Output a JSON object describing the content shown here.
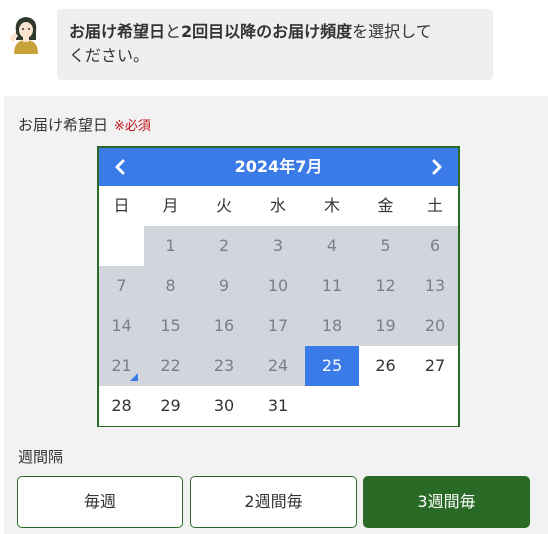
{
  "message": {
    "bold1": "お届け希望日",
    "text1": "と",
    "bold2": "2回目以降のお届け頻度",
    "text2": "を選択して",
    "line2": "ください。"
  },
  "delivery_date": {
    "label": "お届け希望日",
    "required": "※必須"
  },
  "calendar": {
    "title": "2024年7月",
    "weekdays": [
      "日",
      "月",
      "火",
      "水",
      "木",
      "金",
      "土"
    ],
    "weeks": [
      [
        {
          "d": "",
          "s": "empty"
        },
        {
          "d": "1",
          "s": "dis"
        },
        {
          "d": "2",
          "s": "dis"
        },
        {
          "d": "3",
          "s": "dis"
        },
        {
          "d": "4",
          "s": "dis"
        },
        {
          "d": "5",
          "s": "dis"
        },
        {
          "d": "6",
          "s": "dis"
        }
      ],
      [
        {
          "d": "7",
          "s": "dis"
        },
        {
          "d": "8",
          "s": "dis"
        },
        {
          "d": "9",
          "s": "dis"
        },
        {
          "d": "10",
          "s": "dis"
        },
        {
          "d": "11",
          "s": "dis"
        },
        {
          "d": "12",
          "s": "dis"
        },
        {
          "d": "13",
          "s": "dis"
        }
      ],
      [
        {
          "d": "14",
          "s": "dis"
        },
        {
          "d": "15",
          "s": "dis"
        },
        {
          "d": "16",
          "s": "dis"
        },
        {
          "d": "17",
          "s": "dis"
        },
        {
          "d": "18",
          "s": "dis"
        },
        {
          "d": "19",
          "s": "dis"
        },
        {
          "d": "20",
          "s": "dis"
        }
      ],
      [
        {
          "d": "21",
          "s": "dis",
          "today": true
        },
        {
          "d": "22",
          "s": "dis"
        },
        {
          "d": "23",
          "s": "dis"
        },
        {
          "d": "24",
          "s": "dis"
        },
        {
          "d": "25",
          "s": "sel"
        },
        {
          "d": "26",
          "s": "avail"
        },
        {
          "d": "27",
          "s": "avail"
        }
      ],
      [
        {
          "d": "28",
          "s": "avail"
        },
        {
          "d": "29",
          "s": "avail"
        },
        {
          "d": "30",
          "s": "avail"
        },
        {
          "d": "31",
          "s": "avail"
        },
        {
          "d": "",
          "s": "empty"
        },
        {
          "d": "",
          "s": "empty"
        },
        {
          "d": "",
          "s": "empty"
        }
      ]
    ]
  },
  "interval": {
    "label": "週間隔",
    "options": [
      "毎週",
      "2週間毎",
      "3週間毎"
    ],
    "selected_index": 2
  },
  "colors": {
    "accent": "#3b7be8",
    "brand_green": "#2a6a27",
    "required_red": "#c0141c"
  }
}
